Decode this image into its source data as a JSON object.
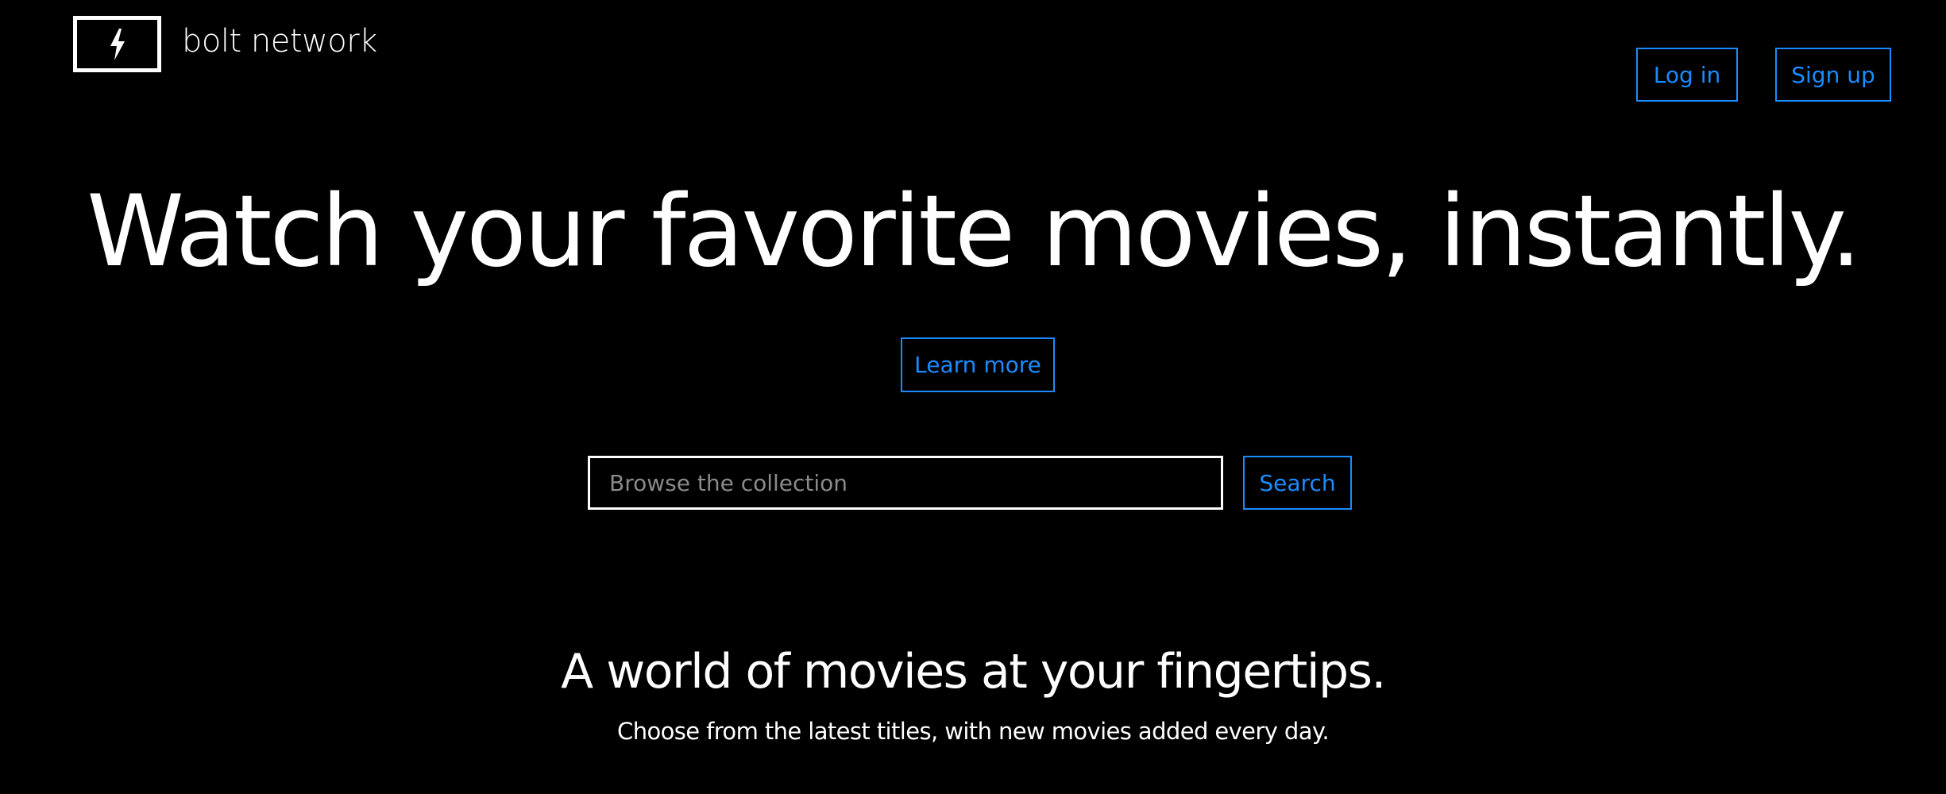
{
  "header": {
    "brand_name": "bolt network",
    "logo_icon": "lightning-bolt-icon",
    "login_label": "Log in",
    "signup_label": "Sign up"
  },
  "hero": {
    "title": "Watch your favorite movies, instantly.",
    "learn_more_label": "Learn more"
  },
  "search": {
    "placeholder": "Browse the collection",
    "value": "",
    "button_label": "Search"
  },
  "section": {
    "title": "A world of movies at your fingertips.",
    "subtitle": "Choose from the latest titles, with new movies added every day."
  },
  "colors": {
    "background": "#000000",
    "text": "#ffffff",
    "accent": "#1a8cff",
    "placeholder": "#8a8a8a"
  }
}
